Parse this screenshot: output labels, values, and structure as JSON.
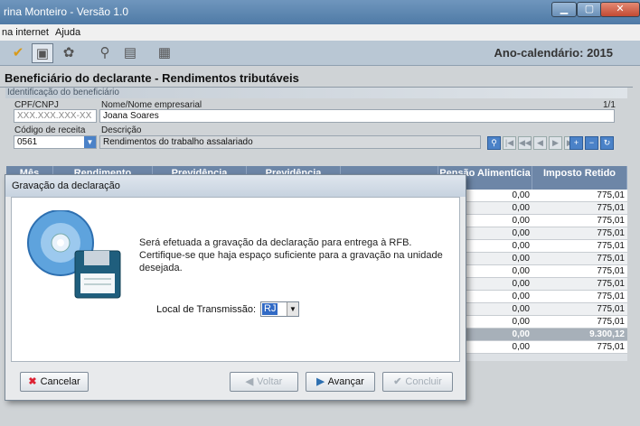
{
  "window": {
    "title": "rina Monteiro - Versão 1.0",
    "minimize": "▁",
    "maximize": "▢",
    "close": "✕"
  },
  "menu": {
    "items": [
      "na internet",
      "Ajuda"
    ]
  },
  "toolbar": {
    "year_label": "Ano-calendário: 2015"
  },
  "page": {
    "title": "Beneficiário do declarante - Rendimentos tributáveis",
    "section": "Identificação do beneficiário",
    "cpf_label": "CPF/CNPJ",
    "cpf_placeholder": "XXX.XXX.XXX-XX",
    "name_label": "Nome/Nome empresarial",
    "name_value": "Joana Soares",
    "page_indicator": "1/1",
    "codigo_label": "Código de receita",
    "codigo_value": "0561",
    "descricao_label": "Descrição",
    "descricao_value": "Rendimentos do trabalho assalariado"
  },
  "table": {
    "headers": [
      "Mês",
      "Rendimento",
      "Previdência",
      "Previdência",
      "",
      "Pensão Alimentícia",
      "Imposto Retido"
    ],
    "rows": [
      {
        "pensao": "0,00",
        "imposto": "775,01"
      },
      {
        "pensao": "0,00",
        "imposto": "775,01"
      },
      {
        "pensao": "0,00",
        "imposto": "775,01"
      },
      {
        "pensao": "0,00",
        "imposto": "775,01"
      },
      {
        "pensao": "0,00",
        "imposto": "775,01"
      },
      {
        "pensao": "0,00",
        "imposto": "775,01"
      },
      {
        "pensao": "0,00",
        "imposto": "775,01"
      },
      {
        "pensao": "0,00",
        "imposto": "775,01"
      },
      {
        "pensao": "0,00",
        "imposto": "775,01"
      },
      {
        "pensao": "0,00",
        "imposto": "775,01"
      },
      {
        "pensao": "0,00",
        "imposto": "775,01"
      }
    ],
    "total": {
      "pensao": "0,00",
      "imposto": "9.300,12"
    },
    "last": {
      "pensao": "0,00",
      "imposto": "775,01"
    }
  },
  "dialog": {
    "title": "Gravação da declaração",
    "message_lines": [
      "Será efetuada a gravação da declaração para entrega à RFB.",
      "Certifique-se que haja espaço suficiente para a gravação na unidade",
      "desejada."
    ],
    "location_label": "Local de Transmissão:",
    "location_value": "RJ",
    "buttons": {
      "cancel": "Cancelar",
      "back": "Voltar",
      "next": "Avançar",
      "finish": "Concluir"
    }
  },
  "colors": {
    "header_blue": "#6d86a7",
    "title_bar": "#5b86b2",
    "selection": "#316ac5"
  }
}
